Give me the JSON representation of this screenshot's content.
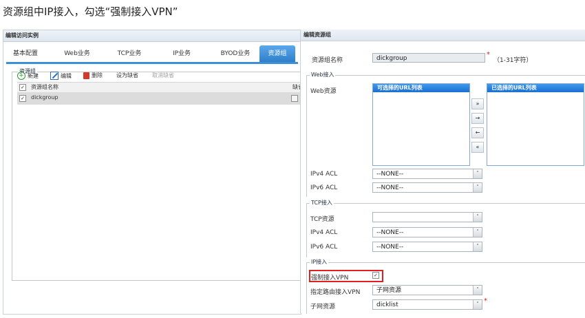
{
  "caption": "资源组中IP接入，勾选“强制接入VPN”",
  "left_panel": {
    "title": "编辑访问实例",
    "tabs": [
      "基本配置",
      "Web业务",
      "TCP业务",
      "IP业务",
      "BYOD业务",
      "资源组"
    ],
    "active_tab": "资源组",
    "fieldset_legend": "资源组",
    "toolbar": {
      "new": "新建",
      "edit": "编辑",
      "delete": "删除",
      "set_default": "设为缺省",
      "cancel_default": "取消缺省"
    },
    "grid": {
      "col_name": "资源组名称",
      "col_default": "缺省",
      "rows": [
        {
          "name": "dickgroup",
          "checked": "✓"
        }
      ]
    }
  },
  "right_panel": {
    "title": "编辑资源组",
    "name_label": "资源组名称",
    "name_value": "dickgroup",
    "name_hint": "（1-31字符）",
    "web_legend": "Web接入",
    "web_resource_label": "Web资源",
    "available_list_header": "可选择的URL列表",
    "selected_list_header": "已选择的URL列表",
    "move_buttons": [
      "»",
      "→",
      "←",
      "«"
    ],
    "web_ipv4_label": "IPv4 ACL",
    "web_ipv4_value": "--NONE--",
    "web_ipv6_label": "IPv6 ACL",
    "web_ipv6_value": "--NONE--",
    "tcp_legend": "TCP接入",
    "tcp_resource_label": "TCP资源",
    "tcp_resource_value": "",
    "tcp_ipv4_label": "IPv4 ACL",
    "tcp_ipv4_value": "--NONE--",
    "tcp_ipv6_label": "IPv6 ACL",
    "tcp_ipv6_value": "--NONE--",
    "ip_legend": "IP接入",
    "force_vpn_label": "强制接入VPN",
    "force_vpn_checked": "✓",
    "route_label": "指定路由接入VPN",
    "route_value": "子网资源",
    "subnet_label": "子网资源",
    "subnet_value": "dicklist",
    "required_mark": "*",
    "dropdown_arrow": "˅"
  },
  "colors": {
    "accent": "#2f7fca",
    "highlight": "#e02020",
    "list_header": "#1a6fd0"
  }
}
